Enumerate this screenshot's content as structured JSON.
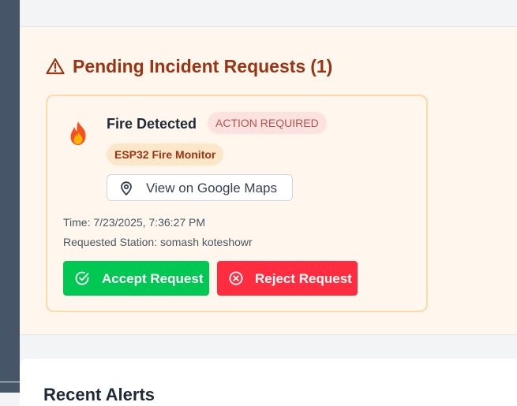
{
  "pending": {
    "title": "Pending Incident Requests",
    "count_text": "(1)",
    "title_icon": "warning-triangle-icon"
  },
  "request": {
    "icon": "fire-icon",
    "title": "Fire Detected",
    "status_badge": "ACTION REQUIRED",
    "device_badge": "ESP32 Fire Monitor",
    "maps_button": "View on Google Maps",
    "time": "Time: 7/23/2025, 7:36:27 PM",
    "station": "Requested Station: somash koteshowr",
    "accept_label": "Accept Request",
    "reject_label": "Reject Request"
  },
  "alerts": {
    "title": "Recent Alerts"
  },
  "colors": {
    "accent_title": "#9a3412",
    "accept": "#00c853",
    "reject": "#ff2d3f",
    "section_bg": "#fff7ed",
    "card_border": "#fcd9a8"
  }
}
